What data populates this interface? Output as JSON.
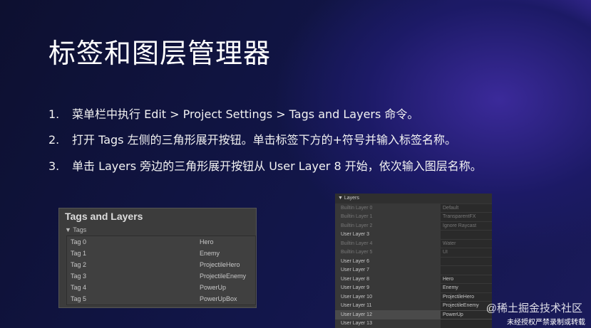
{
  "title": "标签和图层管理器",
  "steps": [
    {
      "num": "1.",
      "text": "菜单栏中执行 Edit > Project Settings > Tags and Layers 命令。"
    },
    {
      "num": "2.",
      "text": "打开 Tags 左侧的三角形展开按钮。单击标签下方的+符号并输入标签名称。"
    },
    {
      "num": "3.",
      "text": "单击 Layers 旁边的三角形展开按钮从 User Layer 8 开始，依次输入图层名称。"
    }
  ],
  "tags_panel": {
    "title": "Tags and Layers",
    "section": "▼ Tags",
    "rows": [
      [
        "Tag 0",
        "Hero"
      ],
      [
        "Tag 1",
        "Enemy"
      ],
      [
        "Tag 2",
        "ProjectileHero"
      ],
      [
        "Tag 3",
        "ProjectileEnemy"
      ],
      [
        "Tag 4",
        "PowerUp"
      ],
      [
        "Tag 5",
        "PowerUpBox"
      ]
    ]
  },
  "layers_panel": {
    "section": "▼ Layers",
    "rows": [
      [
        "Builtin Layer 0",
        "Default"
      ],
      [
        "Builtin Layer 1",
        "TransparentFX"
      ],
      [
        "Builtin Layer 2",
        "Ignore Raycast"
      ],
      [
        "User Layer 3",
        ""
      ],
      [
        "Builtin Layer 4",
        "Water"
      ],
      [
        "Builtin Layer 5",
        "UI"
      ],
      [
        "User Layer 6",
        ""
      ],
      [
        "User Layer 7",
        ""
      ],
      [
        "User Layer 8",
        "Hero"
      ],
      [
        "User Layer 9",
        "Enemy"
      ],
      [
        "User Layer 10",
        "ProjectileHero"
      ],
      [
        "User Layer 11",
        "ProjectileEnemy"
      ],
      [
        "User Layer 12",
        "PowerUp"
      ],
      [
        "User Layer 13",
        ""
      ]
    ]
  },
  "watermark": {
    "site": "@稀土掘金技术社区",
    "notice": "未经授权严禁录制或转载"
  }
}
